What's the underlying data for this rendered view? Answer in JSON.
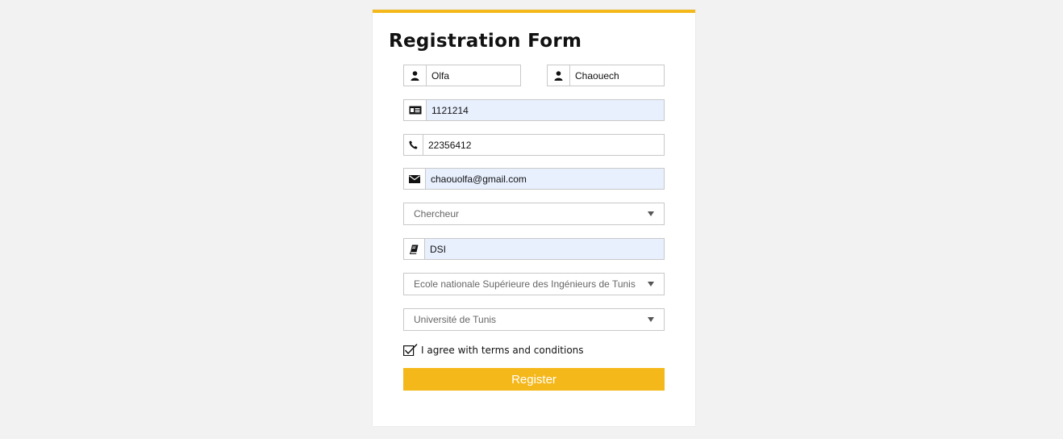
{
  "form": {
    "title": "Registration Form",
    "first_name": {
      "value": "Olfa",
      "icon": "user-icon"
    },
    "last_name": {
      "value": "Chaouech",
      "icon": "user-icon"
    },
    "id_number": {
      "value": "1121214",
      "icon": "id-card-icon"
    },
    "phone": {
      "value": "22356412",
      "icon": "phone-icon"
    },
    "email": {
      "value": "chaouolfa@gmail.com",
      "icon": "envelope-icon"
    },
    "role_select": {
      "selected": "Chercheur"
    },
    "department": {
      "value": "DSI",
      "icon": "book-icon"
    },
    "school_select": {
      "selected": "Ecole nationale Supérieure des Ingénieurs de Tunis"
    },
    "university_select": {
      "selected": "Université de Tunis"
    },
    "terms": {
      "label": "I agree with terms and conditions",
      "checked": true
    },
    "register_label": "Register"
  },
  "colors": {
    "accent": "#f5b81a",
    "autofill": "#e8f0fe",
    "background": "#f2f2f2"
  }
}
